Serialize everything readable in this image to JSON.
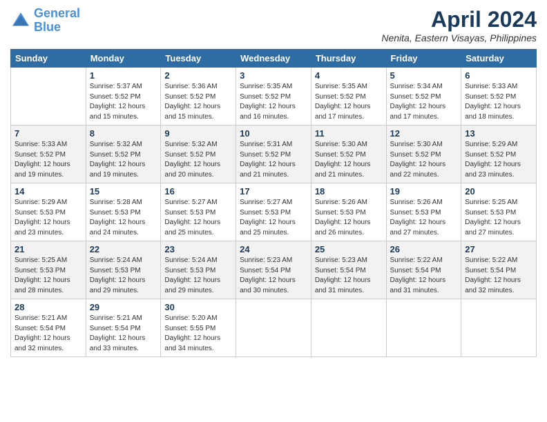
{
  "header": {
    "logo_line1": "General",
    "logo_line2": "Blue",
    "title": "April 2024",
    "location": "Nenita, Eastern Visayas, Philippines"
  },
  "weekdays": [
    "Sunday",
    "Monday",
    "Tuesday",
    "Wednesday",
    "Thursday",
    "Friday",
    "Saturday"
  ],
  "weeks": [
    [
      {
        "day": "",
        "info": ""
      },
      {
        "day": "1",
        "info": "Sunrise: 5:37 AM\nSunset: 5:52 PM\nDaylight: 12 hours\nand 15 minutes."
      },
      {
        "day": "2",
        "info": "Sunrise: 5:36 AM\nSunset: 5:52 PM\nDaylight: 12 hours\nand 15 minutes."
      },
      {
        "day": "3",
        "info": "Sunrise: 5:35 AM\nSunset: 5:52 PM\nDaylight: 12 hours\nand 16 minutes."
      },
      {
        "day": "4",
        "info": "Sunrise: 5:35 AM\nSunset: 5:52 PM\nDaylight: 12 hours\nand 17 minutes."
      },
      {
        "day": "5",
        "info": "Sunrise: 5:34 AM\nSunset: 5:52 PM\nDaylight: 12 hours\nand 17 minutes."
      },
      {
        "day": "6",
        "info": "Sunrise: 5:33 AM\nSunset: 5:52 PM\nDaylight: 12 hours\nand 18 minutes."
      }
    ],
    [
      {
        "day": "7",
        "info": "Sunrise: 5:33 AM\nSunset: 5:52 PM\nDaylight: 12 hours\nand 19 minutes."
      },
      {
        "day": "8",
        "info": "Sunrise: 5:32 AM\nSunset: 5:52 PM\nDaylight: 12 hours\nand 19 minutes."
      },
      {
        "day": "9",
        "info": "Sunrise: 5:32 AM\nSunset: 5:52 PM\nDaylight: 12 hours\nand 20 minutes."
      },
      {
        "day": "10",
        "info": "Sunrise: 5:31 AM\nSunset: 5:52 PM\nDaylight: 12 hours\nand 21 minutes."
      },
      {
        "day": "11",
        "info": "Sunrise: 5:30 AM\nSunset: 5:52 PM\nDaylight: 12 hours\nand 21 minutes."
      },
      {
        "day": "12",
        "info": "Sunrise: 5:30 AM\nSunset: 5:52 PM\nDaylight: 12 hours\nand 22 minutes."
      },
      {
        "day": "13",
        "info": "Sunrise: 5:29 AM\nSunset: 5:52 PM\nDaylight: 12 hours\nand 23 minutes."
      }
    ],
    [
      {
        "day": "14",
        "info": "Sunrise: 5:29 AM\nSunset: 5:53 PM\nDaylight: 12 hours\nand 23 minutes."
      },
      {
        "day": "15",
        "info": "Sunrise: 5:28 AM\nSunset: 5:53 PM\nDaylight: 12 hours\nand 24 minutes."
      },
      {
        "day": "16",
        "info": "Sunrise: 5:27 AM\nSunset: 5:53 PM\nDaylight: 12 hours\nand 25 minutes."
      },
      {
        "day": "17",
        "info": "Sunrise: 5:27 AM\nSunset: 5:53 PM\nDaylight: 12 hours\nand 25 minutes."
      },
      {
        "day": "18",
        "info": "Sunrise: 5:26 AM\nSunset: 5:53 PM\nDaylight: 12 hours\nand 26 minutes."
      },
      {
        "day": "19",
        "info": "Sunrise: 5:26 AM\nSunset: 5:53 PM\nDaylight: 12 hours\nand 27 minutes."
      },
      {
        "day": "20",
        "info": "Sunrise: 5:25 AM\nSunset: 5:53 PM\nDaylight: 12 hours\nand 27 minutes."
      }
    ],
    [
      {
        "day": "21",
        "info": "Sunrise: 5:25 AM\nSunset: 5:53 PM\nDaylight: 12 hours\nand 28 minutes."
      },
      {
        "day": "22",
        "info": "Sunrise: 5:24 AM\nSunset: 5:53 PM\nDaylight: 12 hours\nand 29 minutes."
      },
      {
        "day": "23",
        "info": "Sunrise: 5:24 AM\nSunset: 5:53 PM\nDaylight: 12 hours\nand 29 minutes."
      },
      {
        "day": "24",
        "info": "Sunrise: 5:23 AM\nSunset: 5:54 PM\nDaylight: 12 hours\nand 30 minutes."
      },
      {
        "day": "25",
        "info": "Sunrise: 5:23 AM\nSunset: 5:54 PM\nDaylight: 12 hours\nand 31 minutes."
      },
      {
        "day": "26",
        "info": "Sunrise: 5:22 AM\nSunset: 5:54 PM\nDaylight: 12 hours\nand 31 minutes."
      },
      {
        "day": "27",
        "info": "Sunrise: 5:22 AM\nSunset: 5:54 PM\nDaylight: 12 hours\nand 32 minutes."
      }
    ],
    [
      {
        "day": "28",
        "info": "Sunrise: 5:21 AM\nSunset: 5:54 PM\nDaylight: 12 hours\nand 32 minutes."
      },
      {
        "day": "29",
        "info": "Sunrise: 5:21 AM\nSunset: 5:54 PM\nDaylight: 12 hours\nand 33 minutes."
      },
      {
        "day": "30",
        "info": "Sunrise: 5:20 AM\nSunset: 5:55 PM\nDaylight: 12 hours\nand 34 minutes."
      },
      {
        "day": "",
        "info": ""
      },
      {
        "day": "",
        "info": ""
      },
      {
        "day": "",
        "info": ""
      },
      {
        "day": "",
        "info": ""
      }
    ]
  ]
}
